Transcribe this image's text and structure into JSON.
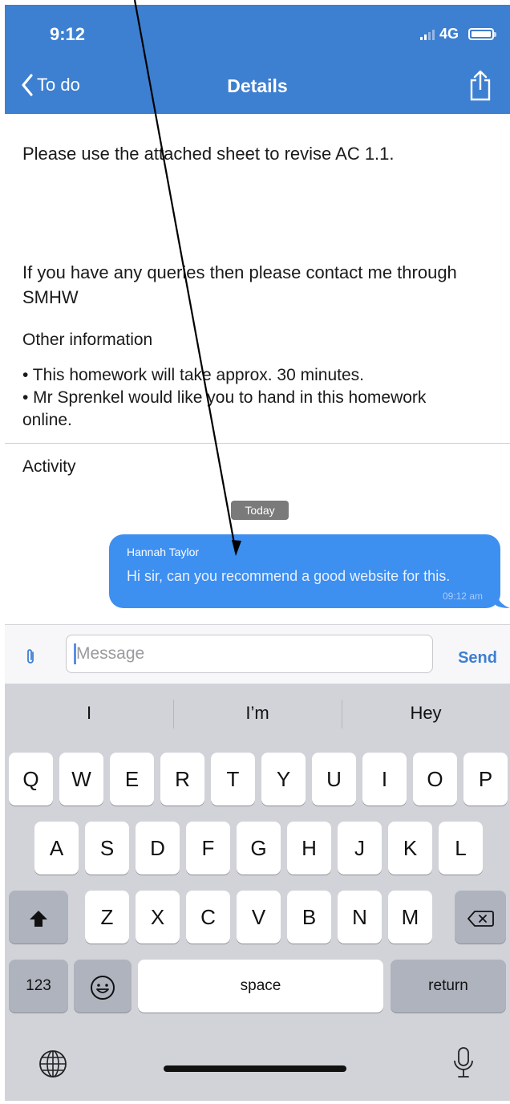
{
  "status": {
    "time": "9:12",
    "network": "4G"
  },
  "nav": {
    "back_label": "To do",
    "title": "Details"
  },
  "content": {
    "paragraph1": "Please use the attached sheet to revise AC 1.1.",
    "paragraph2": "If you have any queries then please contact me through SMHW",
    "other_heading": "Other information",
    "bullet1": "• This homework will take approx. 30 minutes.",
    "bullet2": "• Mr Sprenkel would like you to hand in this homework online.",
    "activity_heading": "Activity"
  },
  "chat": {
    "date_badge": "Today",
    "message": {
      "sender": "Hannah Taylor",
      "text": "Hi sir, can you recommend a good website for this.",
      "time": "09:12 am"
    }
  },
  "composer": {
    "placeholder": "Message",
    "send_label": "Send"
  },
  "keyboard": {
    "suggestions": [
      "I",
      "I’m",
      "Hey"
    ],
    "row1": [
      "Q",
      "W",
      "E",
      "R",
      "T",
      "Y",
      "U",
      "I",
      "O",
      "P"
    ],
    "row2": [
      "A",
      "S",
      "D",
      "F",
      "G",
      "H",
      "J",
      "K",
      "L"
    ],
    "row3": [
      "Z",
      "X",
      "C",
      "V",
      "B",
      "N",
      "M"
    ],
    "numbers_label": "123",
    "space_label": "space",
    "return_label": "return"
  },
  "colors": {
    "accent": "#3d7fd0",
    "bubble": "#3d8ff0"
  }
}
